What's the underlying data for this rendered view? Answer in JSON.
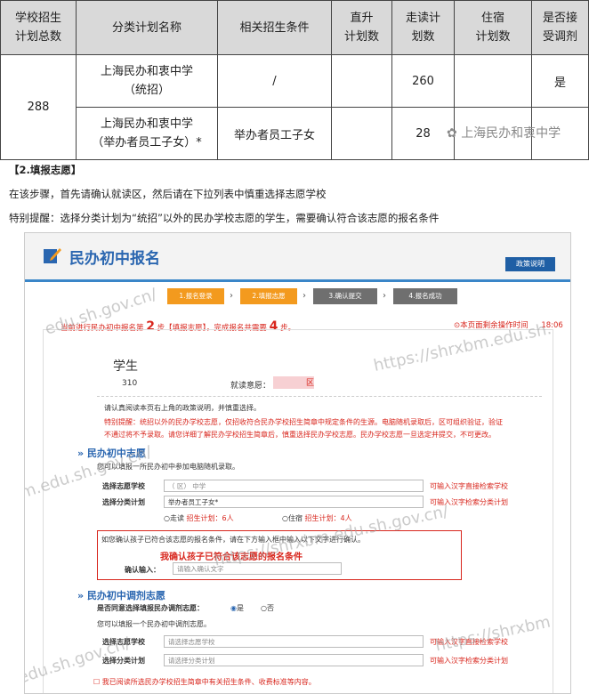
{
  "table": {
    "headers": [
      "学校招生\n计划总数",
      "分类计划名称",
      "相关招生条件",
      "直升\n计划数",
      "走读计\n划数",
      "住宿\n计划数",
      "是否接\n受调剂"
    ],
    "total": "288",
    "rows": [
      {
        "name": "上海民办和衷中学\n（统招）",
        "condition": "/",
        "zhisheng": "",
        "zoudu": "260",
        "zhusu": "",
        "tiaoji": "是"
      },
      {
        "name": "上海民办和衷中学\n（举办者员工子女）*",
        "condition": "举办者员工子女",
        "zhisheng": "",
        "zoudu": "28",
        "zhusu": "",
        "tiaoji": ""
      }
    ],
    "watermark": "上海民办和衷中学"
  },
  "intro": {
    "heading": "【2.填报志愿】",
    "line1": "在该步骤，首先请确认就读区，然后请在下拉列表中慎重选择志愿学校",
    "line2": "特别提醒：选择分类计划为“统招”以外的民办学校志愿的学生，需要确认符合该志愿的报名条件"
  },
  "app": {
    "title": "民办初中报名",
    "policy_button": "政策说明",
    "steps": [
      "1.报名登录",
      "2.填报志愿",
      "3.确认提交",
      "4.报名成功"
    ],
    "progress_prefix": "当前进行民办初中报名第",
    "progress_step": "2",
    "progress_mid": "步【填报志愿】，完成报名共需要",
    "progress_total": "4",
    "progress_suffix": "步。",
    "timer_label": "本页面剩余操作时间",
    "timer_value": "18:06",
    "student_label": "学生",
    "student_id": "310",
    "district_label": "就读意愿：",
    "district_value": "区",
    "notice1": "请认真阅读本页右上角的政策说明，并慎重选择。",
    "notice2": "特别提醒：统招以外的民办学校志愿，仅招收符合民办学校招生简章中规定条件的生源。电脑随机录取后，区可组织验证，验证",
    "notice3": "不通过将不予录取。请您详细了解民办学校招生简章后，慎重选择民办学校志愿。民办学校志愿一旦选定并提交，不可更改。",
    "sec1_title": "民办初中志愿",
    "sec1_sub": "您可以填报一所民办初中参加电脑随机录取。",
    "school_label": "选择志愿学校",
    "school_value": "（       区）            中学",
    "school_hint": "可输入汉字直接检索学校",
    "plan_label": "选择分类计划",
    "plan_value": "举办者员工子女*",
    "plan_hint": "可输入汉字检索分类计划",
    "zoudu_label": "走读",
    "zoudu_plan": "招生计划：6人",
    "zhusu_label": "住宿",
    "zhusu_plan": "招生计划：4人",
    "confirm_notice": "如您确认孩子已符合该志愿的报名条件，请在下方输入框中输入以下文字进行确认。",
    "confirm_text": "我确认孩子已符合该志愿的报名条件",
    "confirm_label": "确认输入：",
    "confirm_placeholder": "请输入确认文字",
    "sec2_title": "民办初中调剂志愿",
    "sec2_question": "是否同意选择填报民办调剂志愿：",
    "yes": "是",
    "no": "否",
    "sec2_sub": "您可以填报一个民办初中调剂志愿。",
    "school2_placeholder": "请选择志愿学校",
    "plan2_placeholder": "请选择分类计划",
    "bottom_check": "我已阅读所选民办学校招生简章中有关招生条件、收费标准等内容。",
    "watermarks": [
      "edu.sh.gov.cn/",
      "https://shrxbm.edu.sh.",
      "xbm.edu.sh.gov.cn/",
      "https://shrxbm.edu.sh.gov.cn/",
      "https://shrxbm",
      "edu.sh.gov.cn/"
    ]
  },
  "colors": {
    "accent": "#2a66b0",
    "orange": "#f39a1e",
    "red": "#d8261d",
    "gray_step": "#6f6f6f"
  }
}
